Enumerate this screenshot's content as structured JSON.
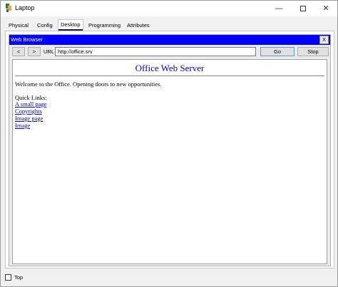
{
  "window": {
    "title": "Laptop",
    "minimize_glyph": "—",
    "close_glyph": "✕"
  },
  "tabs": [
    {
      "label": "Physical",
      "active": false
    },
    {
      "label": "Config",
      "active": false
    },
    {
      "label": "Desktop",
      "active": true
    },
    {
      "label": "Programming",
      "active": false
    },
    {
      "label": "Attributes",
      "active": false
    }
  ],
  "browser": {
    "title": "Web Browser",
    "close_label": "X",
    "back_label": "<",
    "forward_label": ">",
    "url_label": "URL",
    "url_value": "http://office.srv",
    "go_label": "Go",
    "stop_label": "Stop"
  },
  "page": {
    "heading": "Office Web Server",
    "welcome": "Welcome to the Office. Opening doors to new opportunities.",
    "quick_links_label": "Quick Links:",
    "links": [
      "A small page",
      "Copyrights",
      "Image page",
      "Image"
    ]
  },
  "footer": {
    "top_label": "Top",
    "top_checked": false
  },
  "colors": {
    "browser_title_bg": "#0000ff",
    "heading": "#0000cc",
    "link": "#0000ee"
  },
  "icons": {
    "app": "packet-tracer-laptop-icon"
  }
}
